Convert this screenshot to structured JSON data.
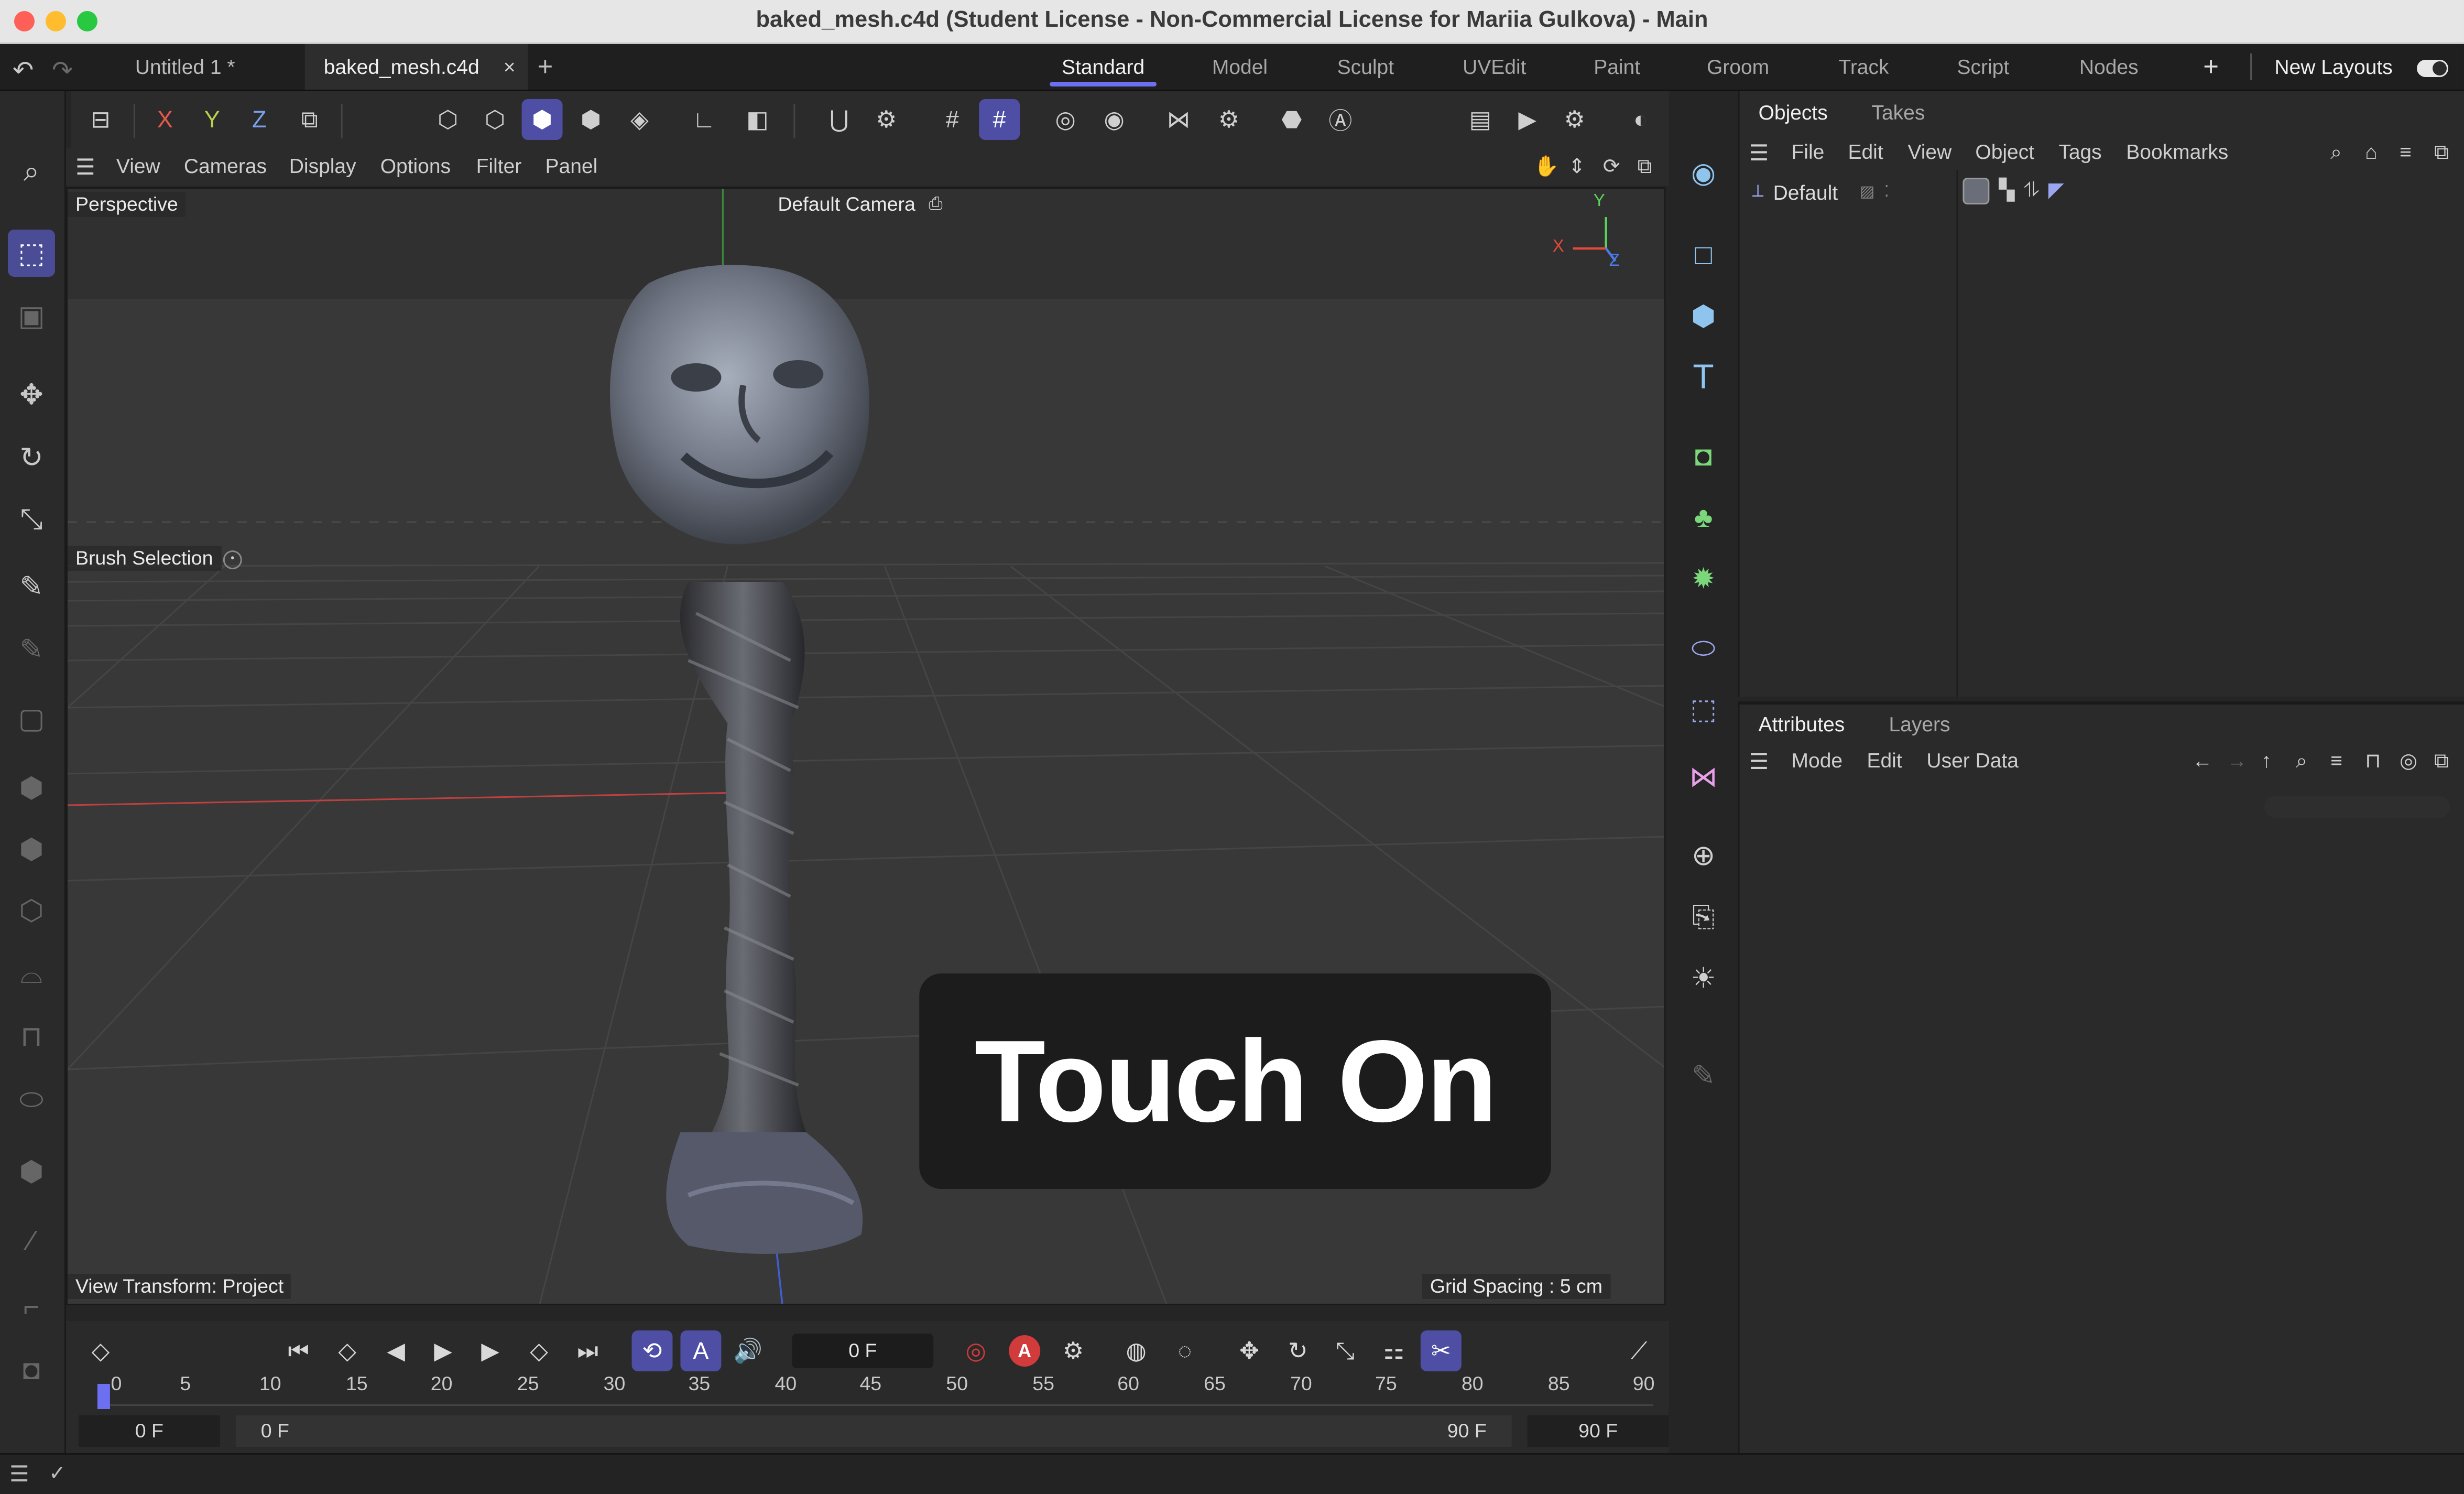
{
  "window": {
    "title": "baked_mesh.c4d (Student License - Non-Commercial License for Mariia Gulkova) - Main",
    "traffic_colors": [
      "#fe5f57",
      "#febc2e",
      "#28c840"
    ]
  },
  "doc_tabs": [
    {
      "label": "Untitled 1 *"
    },
    {
      "label": "baked_mesh.c4d",
      "close": "×"
    }
  ],
  "new_tab": "+",
  "layout_tabs": [
    "Standard",
    "Model",
    "Sculpt",
    "UVEdit",
    "Paint",
    "Groom",
    "Track",
    "Script",
    "Nodes"
  ],
  "layout_add": "+",
  "new_layouts": "New Layouts",
  "axis_buttons": [
    "X",
    "Y",
    "Z"
  ],
  "view_menu": [
    "View",
    "Cameras",
    "Display",
    "Options",
    "Filter",
    "Panel"
  ],
  "viewport": {
    "name": "Perspective",
    "camera": "Default Camera",
    "hud_brush": "Brush Selection",
    "view_transform": "View Transform: Project",
    "grid_spacing": "Grid Spacing : 5 cm",
    "axis_x": "X",
    "axis_y": "Y",
    "axis_z": "Z"
  },
  "overlay_text": "Touch On",
  "objects_panel": {
    "tabs": [
      "Objects",
      "Takes"
    ],
    "menu": [
      "File",
      "Edit",
      "View",
      "Object",
      "Tags",
      "Bookmarks"
    ],
    "object_name": "Default"
  },
  "attributes_panel": {
    "tabs": [
      "Attributes",
      "Layers"
    ],
    "menu": [
      "Mode",
      "Edit",
      "User Data"
    ]
  },
  "timeline": {
    "current_frame": "0 F",
    "ruler": [
      "0",
      "5",
      "10",
      "15",
      "20",
      "25",
      "30",
      "35",
      "40",
      "45",
      "50",
      "55",
      "60",
      "65",
      "70",
      "75",
      "80",
      "85",
      "90"
    ],
    "range_start": "0 F",
    "range_in": "0 F",
    "range_out": "90 F",
    "range_end": "90 F"
  },
  "icons": {
    "undo": "undo-icon",
    "redo": "redo-icon",
    "play": "play-icon",
    "record": "record-icon",
    "autokey": "A"
  },
  "colors": {
    "accent": "#4e4fa4",
    "viewport_bg": "#363636",
    "axis_x": "#e04a3a",
    "axis_y": "#5ad05a",
    "axis_z": "#4a7ae8",
    "record_red": "#d23b3b"
  }
}
